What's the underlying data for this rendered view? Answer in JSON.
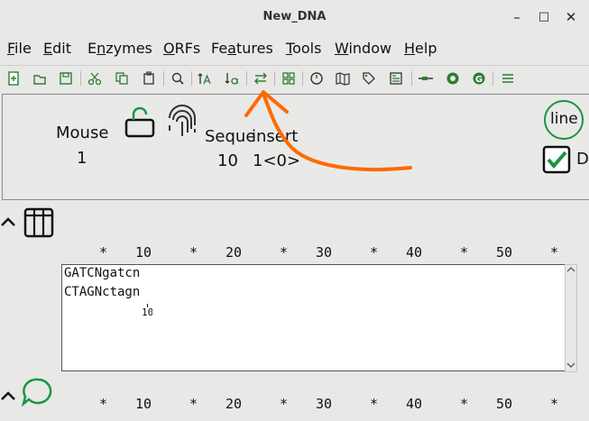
{
  "window": {
    "title": "New_DNA",
    "minimize": "–",
    "maximize": "□",
    "close": "✕"
  },
  "menu": [
    {
      "pre": "",
      "u": "F",
      "post": "ile"
    },
    {
      "pre": "",
      "u": "E",
      "post": "dit"
    },
    {
      "pre": "E",
      "u": "n",
      "post": "zymes"
    },
    {
      "pre": "",
      "u": "O",
      "post": "RFs"
    },
    {
      "pre": "Fe",
      "u": "a",
      "post": "tures"
    },
    {
      "pre": "",
      "u": "T",
      "post": "ools"
    },
    {
      "pre": "",
      "u": "W",
      "post": "indow"
    },
    {
      "pre": "",
      "u": "H",
      "post": "elp"
    }
  ],
  "toolbar_icons": [
    "new-file-icon",
    "open-icon",
    "save-icon",
    "cut-icon",
    "copy-icon",
    "paste-icon",
    "find-icon",
    "uppercase-icon",
    "lowercase-icon",
    "reverse-complement-icon",
    "grid-icon",
    "circle-map-icon",
    "map-icon",
    "tag-icon",
    "document-list-icon",
    "line-icon",
    "gear-green-icon",
    "g-circle-icon",
    "menu-lines-icon"
  ],
  "info": {
    "mouse_label": "Mouse",
    "mouse_value": "1",
    "sequence_label": "Seque",
    "insert_label": "insert",
    "sequence_value": "10",
    "insert_value": "1<0>",
    "line_label": "line",
    "checkbox_label": "D"
  },
  "ruler": {
    "marks": [
      "*",
      "10",
      "*",
      "20",
      "*",
      "30",
      "*",
      "40",
      "*",
      "50",
      "*"
    ]
  },
  "sequence": {
    "top": "GATCNgatcn",
    "bottom": "CTAGNctagn",
    "position": "10"
  },
  "colors": {
    "accent": "#1a9641",
    "annotation": "#ff6a00"
  }
}
